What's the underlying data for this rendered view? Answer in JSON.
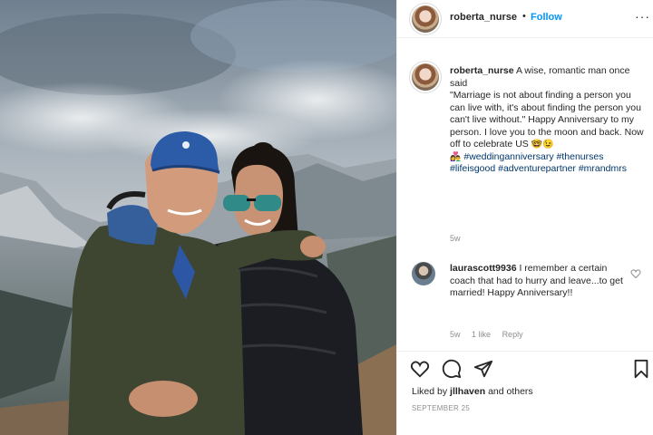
{
  "post": {
    "author": "roberta_nurse",
    "dot": "•",
    "follow_label": "Follow",
    "more_label": "···",
    "caption": {
      "username": "roberta_nurse",
      "text_1": "A wise, romantic man once said",
      "text_2": "\"Marriage is not about finding a person you can live with, it's about finding the person you can't live without.\" Happy Anniversary to my person. I love you to the moon and back. Now off to celebrate US",
      "emoji_1": "🤓😉",
      "emoji_2": "👩‍❤️‍👨",
      "hashtags": "#weddinganniversary #thenurses #lifeisgood #adventurepartner #mrandmrs",
      "time": "5w"
    },
    "comment": {
      "username": "laurascott9936",
      "text": "I remember a certain coach that had to hurry and leave...to get married! Happy Anniversary!!",
      "time": "5w",
      "likes_label": "1 like",
      "reply_label": "Reply"
    },
    "likes": {
      "prefix": "Liked by",
      "user": "jllhaven",
      "suffix": "and others"
    },
    "date": "SEPTEMBER 25"
  },
  "icons": {
    "more": "more-dots-icon",
    "heart": "heart-icon",
    "comment": "comment-bubble-icon",
    "share": "paper-plane-icon",
    "save": "bookmark-icon"
  },
  "colors": {
    "follow": "#0095f6",
    "hashtag": "#00376b",
    "muted": "#8e8e8e"
  }
}
